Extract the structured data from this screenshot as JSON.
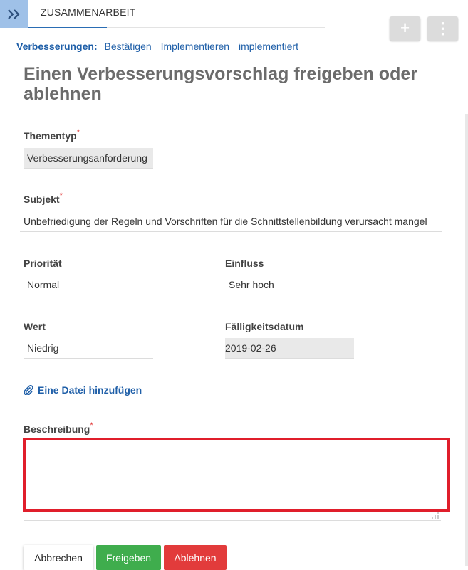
{
  "nav": {
    "tab_label": "ZUSAMMENARBEIT"
  },
  "toolbar": {
    "add_glyph": "+",
    "more_glyph": "⋮"
  },
  "breadcrumb": {
    "lead": "Verbesserungen:",
    "links": [
      "Bestätigen",
      "Implementieren",
      "implementiert"
    ]
  },
  "page": {
    "title": "Einen Verbesserungsvorschlag freigeben oder ablehnen"
  },
  "form": {
    "required_mark": "*",
    "thementyp": {
      "label": "Thementyp",
      "value": "Verbesserungsanforderung"
    },
    "subjekt": {
      "label": "Subjekt",
      "value": "Unbefriedigung der Regeln und Vorschriften für die Schnittstellenbildung verursacht mangel"
    },
    "prioritaet": {
      "label": "Priorität",
      "value": "Normal"
    },
    "einfluss": {
      "label": "Einfluss",
      "value": "Sehr hoch"
    },
    "wert": {
      "label": "Wert",
      "value": "Niedrig"
    },
    "faelligkeit": {
      "label": "Fälligkeitsdatum",
      "value": "2019-02-26"
    },
    "attach_label": "Eine Datei hinzufügen",
    "beschreibung": {
      "label": "Beschreibung",
      "value": ""
    }
  },
  "actions": {
    "cancel": "Abbrechen",
    "approve": "Freigeben",
    "reject": "Ablehnen"
  },
  "colors": {
    "accent": "#1f5fa8",
    "approve": "#3fad4d",
    "reject": "#e23b3b",
    "highlight_border": "#e01e2b"
  }
}
